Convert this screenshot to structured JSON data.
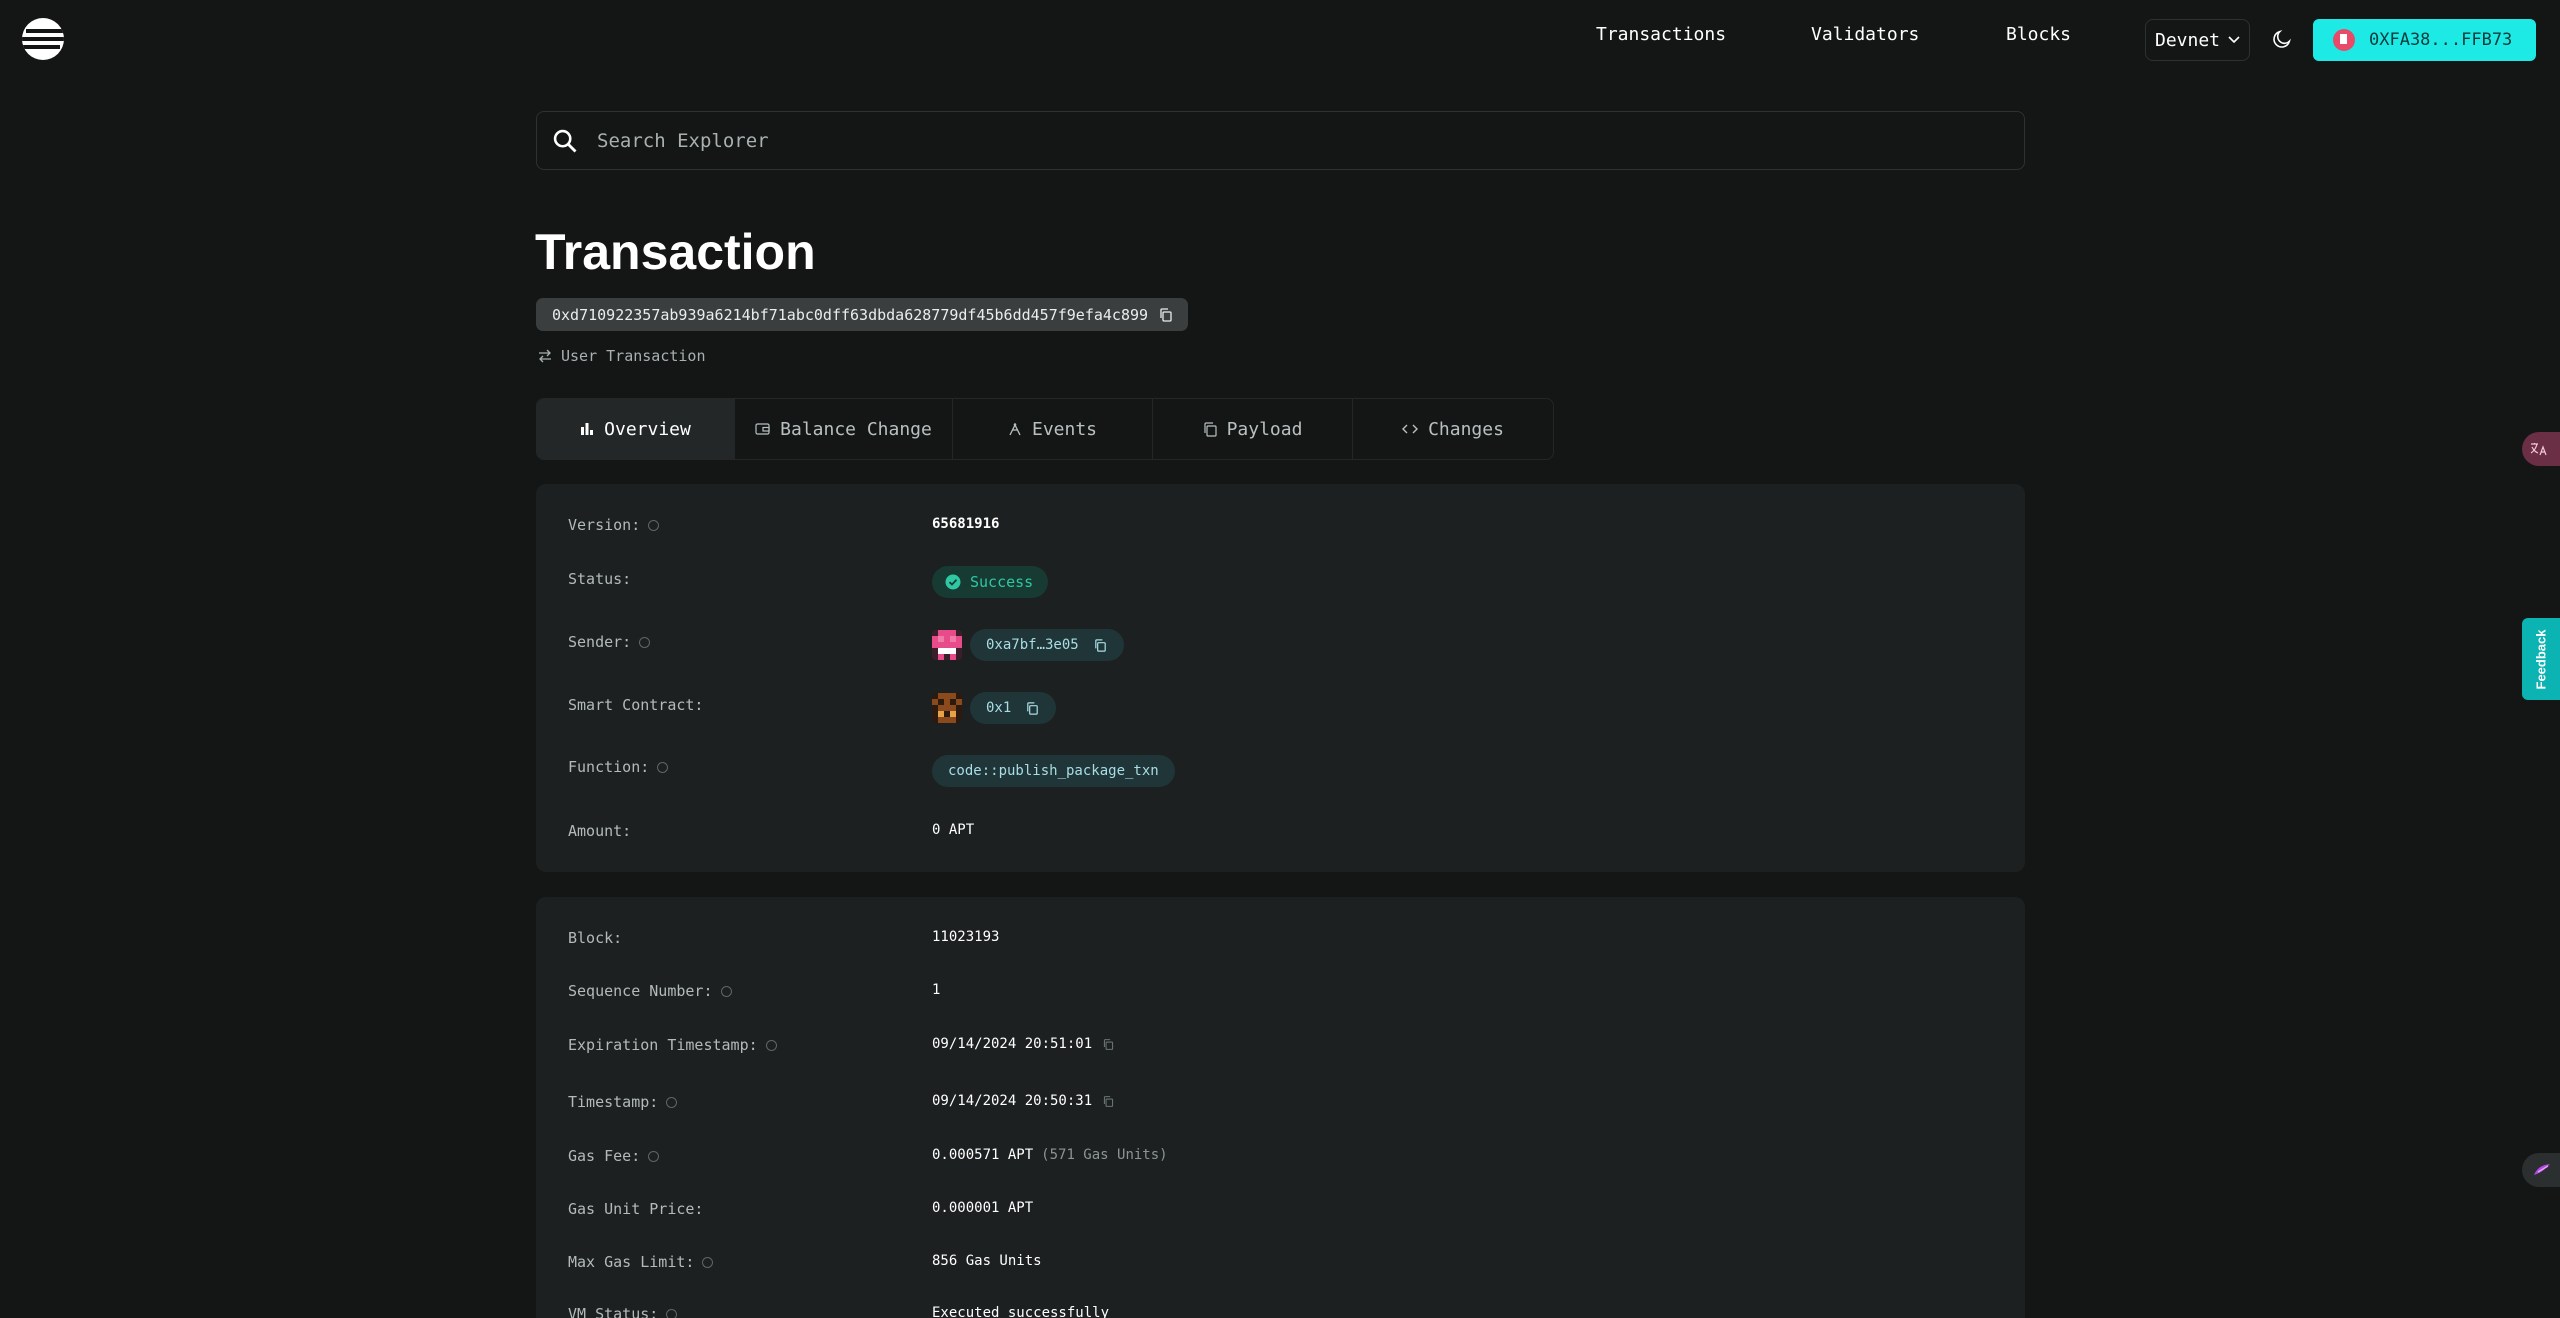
{
  "header": {
    "nav": [
      {
        "label": "Transactions"
      },
      {
        "label": "Validators"
      },
      {
        "label": "Blocks"
      }
    ],
    "network": {
      "label": "Devnet"
    },
    "wallet": {
      "label": "0XFA38...FFB73"
    }
  },
  "search": {
    "placeholder": "Search Explorer"
  },
  "page": {
    "title": "Transaction",
    "hash": "0xd710922357ab939a6214bf71abc0dff63dbda628779df45b6dd457f9efa4c899",
    "type": "User Transaction"
  },
  "tabs": [
    {
      "label": "Overview",
      "icon": "bar-chart-icon",
      "active": true
    },
    {
      "label": "Balance Change",
      "icon": "wallet-icon",
      "active": false
    },
    {
      "label": "Events",
      "icon": "events-icon",
      "active": false
    },
    {
      "label": "Payload",
      "icon": "payload-icon",
      "active": false
    },
    {
      "label": "Changes",
      "icon": "code-icon",
      "active": false
    }
  ],
  "overview": {
    "version_label": "Version:",
    "version": "65681916",
    "status_label": "Status:",
    "status": "Success",
    "sender_label": "Sender:",
    "sender": "0xa7bf…3e05",
    "contract_label": "Smart Contract:",
    "contract": "0x1",
    "function_label": "Function:",
    "function": "code::publish_package_txn",
    "amount_label": "Amount:",
    "amount": "0 APT"
  },
  "details": {
    "block_label": "Block:",
    "block": "11023193",
    "sequence_label": "Sequence Number:",
    "sequence": "1",
    "expiration_label": "Expiration Timestamp:",
    "expiration": "09/14/2024 20:51:01",
    "timestamp_label": "Timestamp:",
    "timestamp": "09/14/2024 20:50:31",
    "gas_fee_label": "Gas Fee:",
    "gas_fee": "0.000571 APT",
    "gas_units": "(571 Gas Units)",
    "gas_price_label": "Gas Unit Price:",
    "gas_price": "0.000001 APT",
    "max_gas_label": "Max Gas Limit:",
    "max_gas": "856 Gas Units",
    "vm_status_label": "VM Status:",
    "vm_status": "Executed successfully"
  },
  "side": {
    "feedback": "Feedback"
  },
  "colors": {
    "accent": "#1de9e5",
    "success": "#2ec8a4",
    "background": "#141616",
    "card": "#1d2020"
  }
}
